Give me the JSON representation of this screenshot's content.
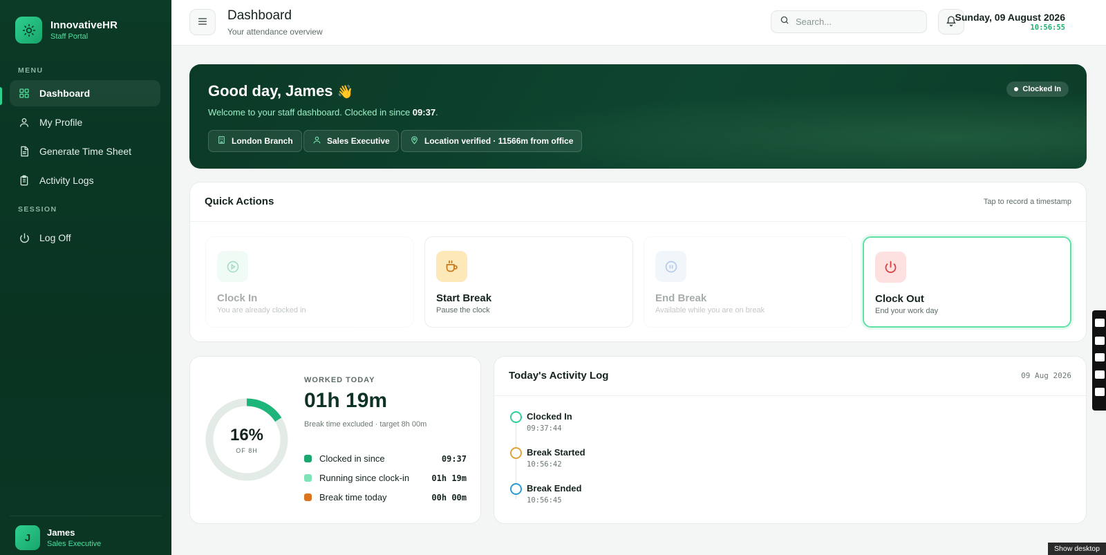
{
  "brand": {
    "name": "InnovativeHR",
    "subtitle": "Staff Portal"
  },
  "sidebar": {
    "menu_label": "MENU",
    "session_label": "SESSION",
    "items": [
      {
        "label": "Dashboard",
        "icon": "grid-icon",
        "active": true
      },
      {
        "label": "My Profile",
        "icon": "user-icon"
      },
      {
        "label": "Generate Time Sheet",
        "icon": "document-icon"
      },
      {
        "label": "Activity Logs",
        "icon": "clipboard-icon"
      }
    ],
    "session_items": [
      {
        "label": "Log Off",
        "icon": "power-icon"
      }
    ],
    "user": {
      "initial": "J",
      "name": "James",
      "role": "Sales Executive"
    }
  },
  "topbar": {
    "title": "Dashboard",
    "subtitle": "Your attendance overview",
    "search_placeholder": "Search...",
    "date": "Sunday, 09 August 2026",
    "time": "10:56:55"
  },
  "hero": {
    "greeting": "Good day, James",
    "wave": "👋",
    "welcome_prefix": "Welcome to your staff dashboard. Clocked in since ",
    "clocked_time": "09:37",
    "welcome_suffix": ".",
    "status": "Clocked In",
    "chips": [
      {
        "label": "London Branch",
        "icon": "building-icon"
      },
      {
        "label": "Sales Executive",
        "icon": "user-icon"
      },
      {
        "label": "Location verified · 11566m from office",
        "icon": "location-pin-icon"
      }
    ]
  },
  "quick_actions": {
    "title": "Quick Actions",
    "hint": "Tap to record a timestamp",
    "actions": [
      {
        "title": "Clock In",
        "subtitle": "You are already clocked in",
        "icon": "play-icon",
        "disabled": true
      },
      {
        "title": "Start Break",
        "subtitle": "Pause the clock",
        "icon": "coffee-cup-icon",
        "disabled": false
      },
      {
        "title": "End Break",
        "subtitle": "Available while you are on break",
        "icon": "pause-icon",
        "disabled": true
      },
      {
        "title": "Clock Out",
        "subtitle": "End your work day",
        "icon": "power-icon",
        "disabled": false
      }
    ]
  },
  "worked": {
    "label": "WORKED TODAY",
    "value": "01h 19m",
    "note": "Break time excluded · target 8h 00m",
    "percent_text": "16%",
    "percent": 16,
    "of_label": "OF 8H",
    "rows": [
      {
        "label": "Clocked in since",
        "value": "09:37",
        "color": "#1aa870"
      },
      {
        "label": "Running since clock-in",
        "value": "01h 19m",
        "color": "#7fe3b8"
      },
      {
        "label": "Break time today",
        "value": "00h 00m",
        "color": "#d9751f"
      }
    ]
  },
  "activity_log": {
    "title": "Today's Activity Log",
    "date": "09 Aug 2026",
    "entries": [
      {
        "title": "Clocked In",
        "time": "09:37:44",
        "color": "#2fcf95"
      },
      {
        "title": "Break Started",
        "time": "10:56:42",
        "color": "#e2a23a"
      },
      {
        "title": "Break Ended",
        "time": "10:56:45",
        "color": "#2a9bd6"
      }
    ]
  },
  "overlay": {
    "show_desktop": "Show desktop"
  },
  "colors": {
    "sidebar": "#0b3a27",
    "accent": "#2fd08f",
    "hero": "#0e4530"
  }
}
